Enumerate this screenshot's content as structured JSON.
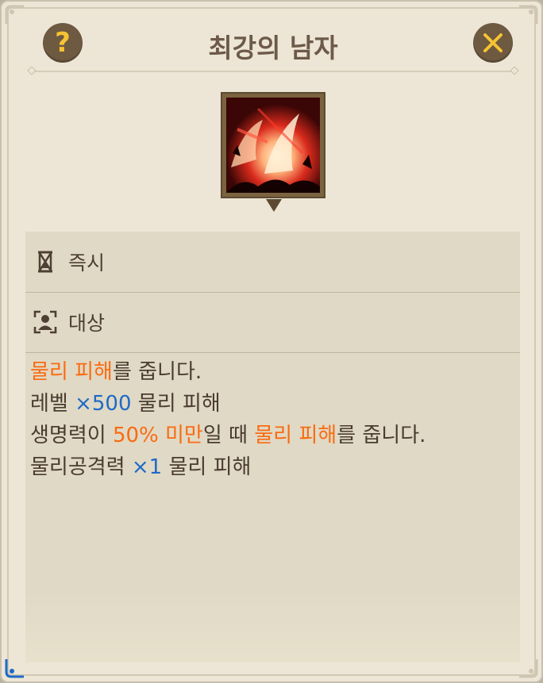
{
  "header": {
    "title": "최강의 남자",
    "help_icon": "question-icon",
    "close_icon": "close-icon"
  },
  "skill": {
    "icon": "red-fire-slash-skill-icon"
  },
  "info": {
    "cast_time_icon": "hourglass-icon",
    "cast_time": "즉시",
    "target_icon": "target-person-icon",
    "target": "대상"
  },
  "description": {
    "line1": {
      "a": "물리 피해",
      "b": "를 줍니다."
    },
    "line2": {
      "a": "레벨 ",
      "b": "×500",
      "c": " 물리 피해"
    },
    "line3": {
      "a": "생명력이 ",
      "b": "50% 미만",
      "c": "일 때 ",
      "d": "물리 피해",
      "e": "를 줍니다."
    },
    "line4": {
      "a": "물리공격력 ",
      "b": "×1",
      "c": " 물리 피해"
    }
  },
  "colors": {
    "background": "#ede6d6",
    "info_box": "#e0d9c5",
    "text": "#4a3c30",
    "highlight_orange": "#fa6b11",
    "highlight_blue": "#1e6ac8",
    "button_brown": "#6e5941",
    "button_icon_yellow": "#f6c332"
  }
}
